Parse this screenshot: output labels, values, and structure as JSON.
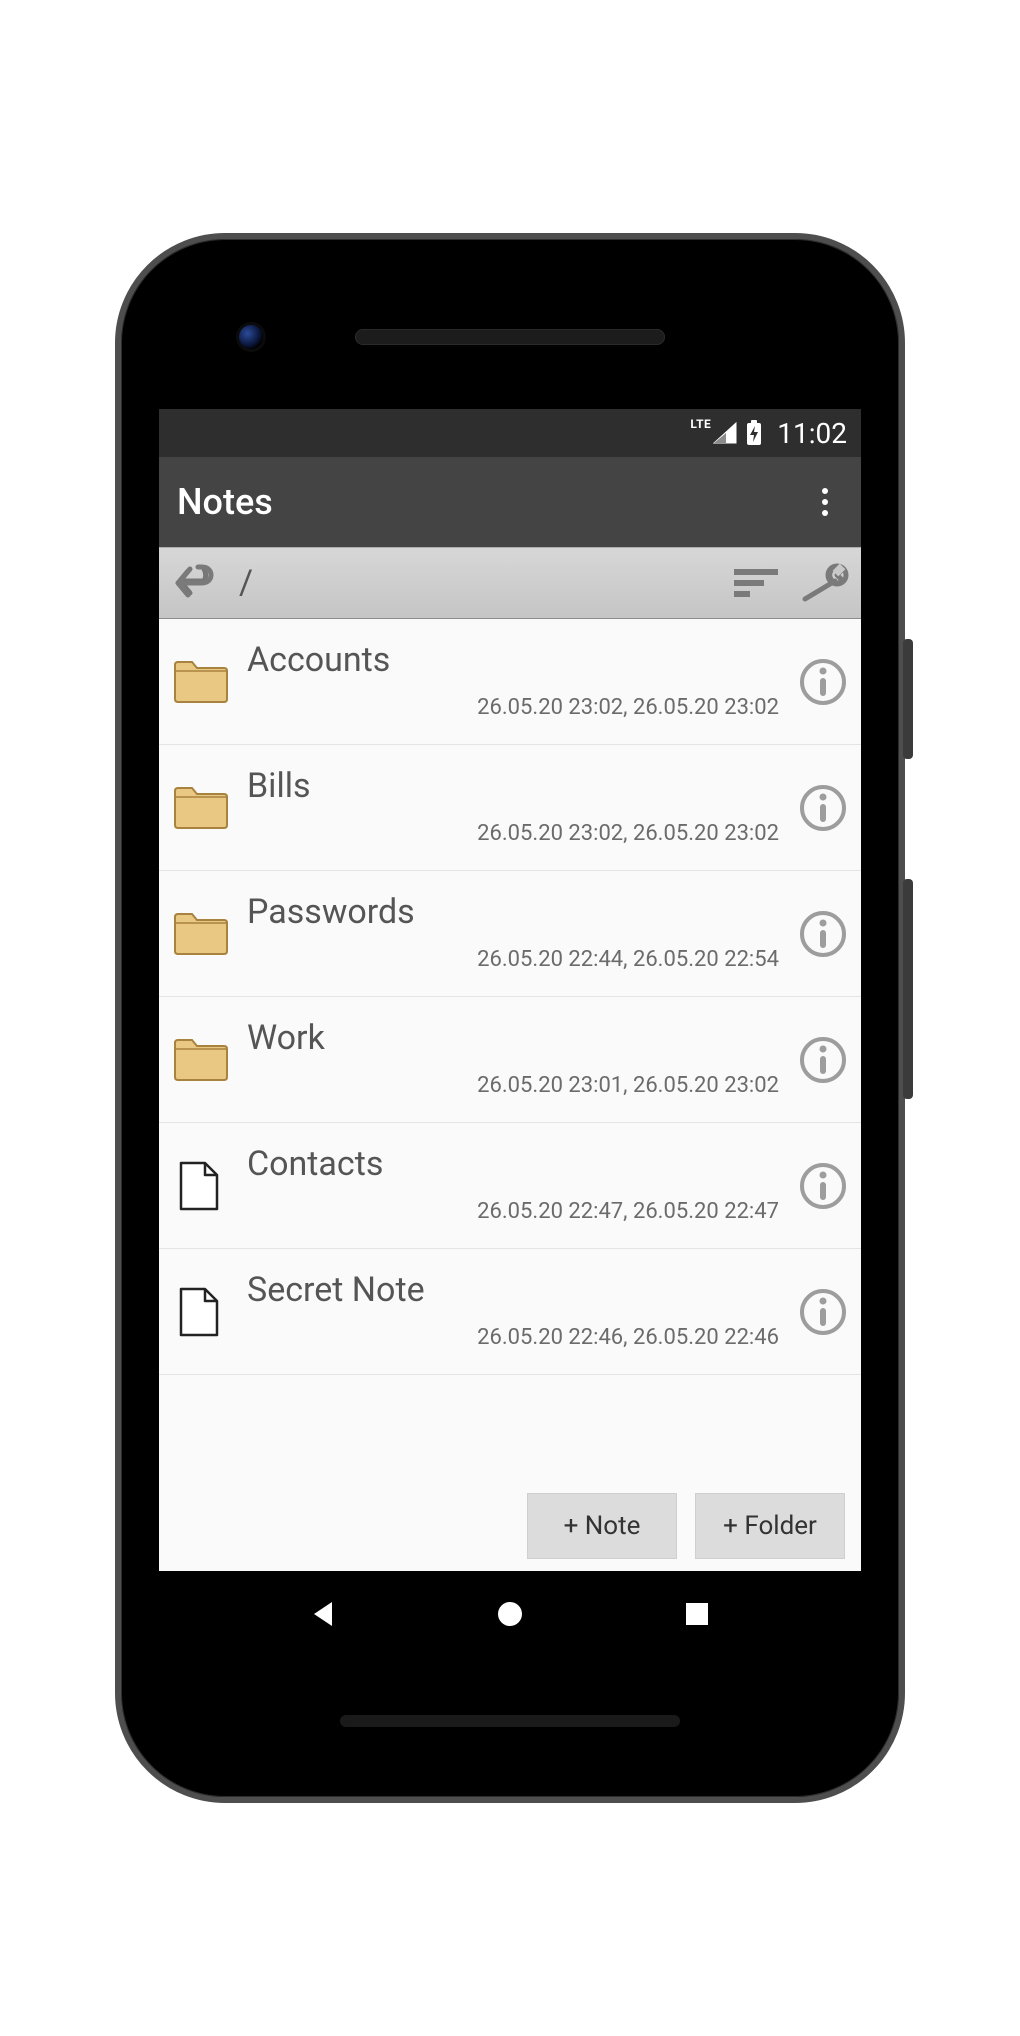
{
  "status_bar": {
    "network_label": "LTE",
    "time": "11:02"
  },
  "app_bar": {
    "title": "Notes"
  },
  "toolbar": {
    "breadcrumb": "/"
  },
  "list": {
    "items": [
      {
        "type": "folder",
        "title": "Accounts",
        "meta": "26.05.20 23:02, 26.05.20 23:02"
      },
      {
        "type": "folder",
        "title": "Bills",
        "meta": "26.05.20 23:02, 26.05.20 23:02"
      },
      {
        "type": "folder",
        "title": "Passwords",
        "meta": "26.05.20 22:44, 26.05.20 22:54"
      },
      {
        "type": "folder",
        "title": "Work",
        "meta": "26.05.20 23:01, 26.05.20 23:02"
      },
      {
        "type": "note",
        "title": "Contacts",
        "meta": "26.05.20 22:47, 26.05.20 22:47"
      },
      {
        "type": "note",
        "title": "Secret Note",
        "meta": "26.05.20 22:46, 26.05.20 22:46"
      }
    ]
  },
  "actions": {
    "add_note": "+ Note",
    "add_folder": "+ Folder"
  }
}
